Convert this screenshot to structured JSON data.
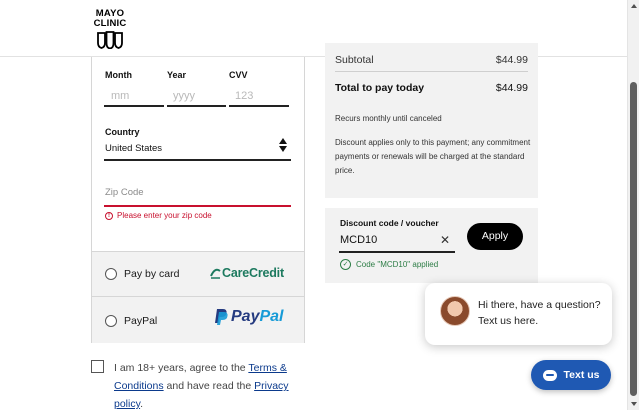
{
  "header": {
    "logo_line1": "MAYO",
    "logo_line2": "CLINIC"
  },
  "card_form": {
    "month_label": "Month",
    "month_placeholder": "mm",
    "year_label": "Year",
    "year_placeholder": "yyyy",
    "cvv_label": "CVV",
    "cvv_placeholder": "123",
    "country_label": "Country",
    "country_value": "United States",
    "zip_placeholder": "Zip Code",
    "zip_error": "Please enter your zip code"
  },
  "payment_options": [
    {
      "label": "Pay by card",
      "logo_text": "CareCredit"
    },
    {
      "label": "PayPal",
      "logo_text_a": "Pay",
      "logo_text_b": "Pal"
    }
  ],
  "agreement": {
    "text_a": "I am 18+ years, agree to the ",
    "link_terms": "Terms & Conditions",
    "text_b": " and have read the ",
    "link_privacy": "Privacy policy",
    "text_c": "."
  },
  "summary": {
    "subtotal_label": "Subtotal",
    "subtotal_value": "$44.99",
    "total_label": "Total to pay today",
    "total_value": "$44.99",
    "recurs_note": "Recurs monthly until canceled",
    "discount_note": "Discount applies only to this payment; any commitment payments or renewals will be charged at the standard price."
  },
  "discount": {
    "label": "Discount code / voucher",
    "value": "MCD10",
    "apply_label": "Apply",
    "applied_message": "Code \"MCD10\" applied"
  },
  "chat": {
    "greeting": "Hi there, have a question? Text us here.",
    "button_label": "Text us"
  },
  "colors": {
    "error": "#c8102e",
    "success": "#2d7d46",
    "chat_button": "#1f59b3",
    "carecredit": "#1d7a5f",
    "paypal_dark": "#253b80",
    "paypal_light": "#179bd7"
  }
}
